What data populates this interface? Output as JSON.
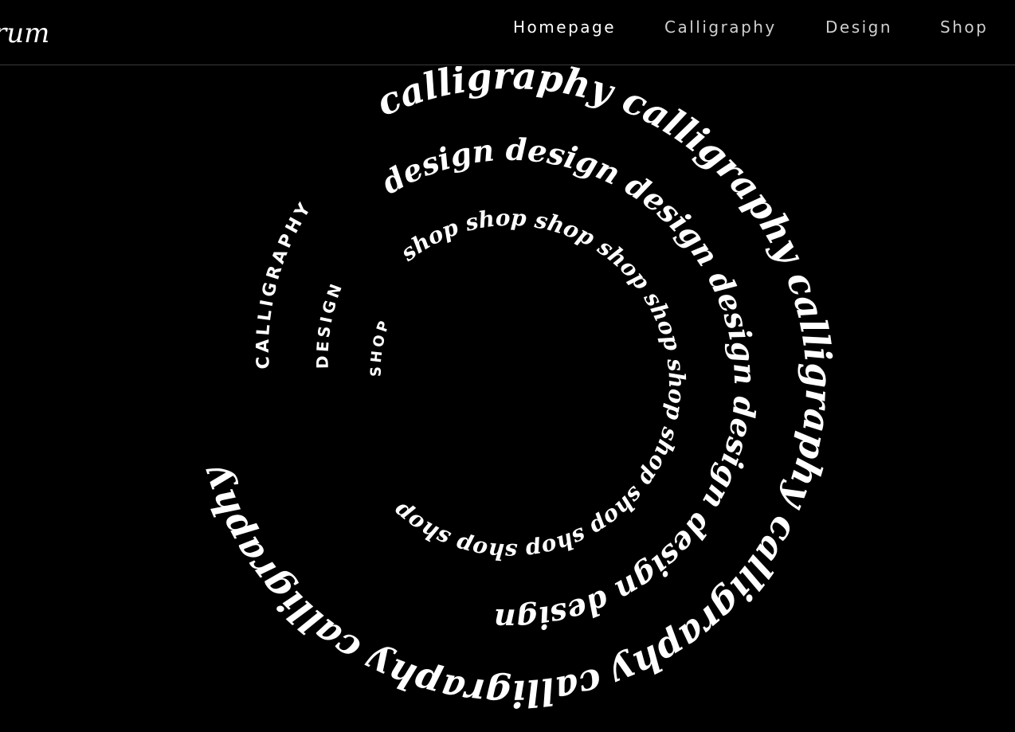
{
  "header": {
    "logo_text": "rum",
    "nav": [
      {
        "label": "Homepage",
        "active": true
      },
      {
        "label": "Calligraphy",
        "active": false
      },
      {
        "label": "Design",
        "active": false
      },
      {
        "label": "Shop",
        "active": false
      }
    ]
  },
  "hero": {
    "rings": [
      {
        "label": "CALLIGRAPHY",
        "word": "calligraphy"
      },
      {
        "label": "DESIGN",
        "word": "design"
      },
      {
        "label": "SHOP",
        "word": "shop"
      }
    ]
  },
  "colors": {
    "background": "#000000",
    "text": "#ffffff",
    "nav_inactive": "#cfcfcf",
    "divider": "#3a3a3a"
  }
}
